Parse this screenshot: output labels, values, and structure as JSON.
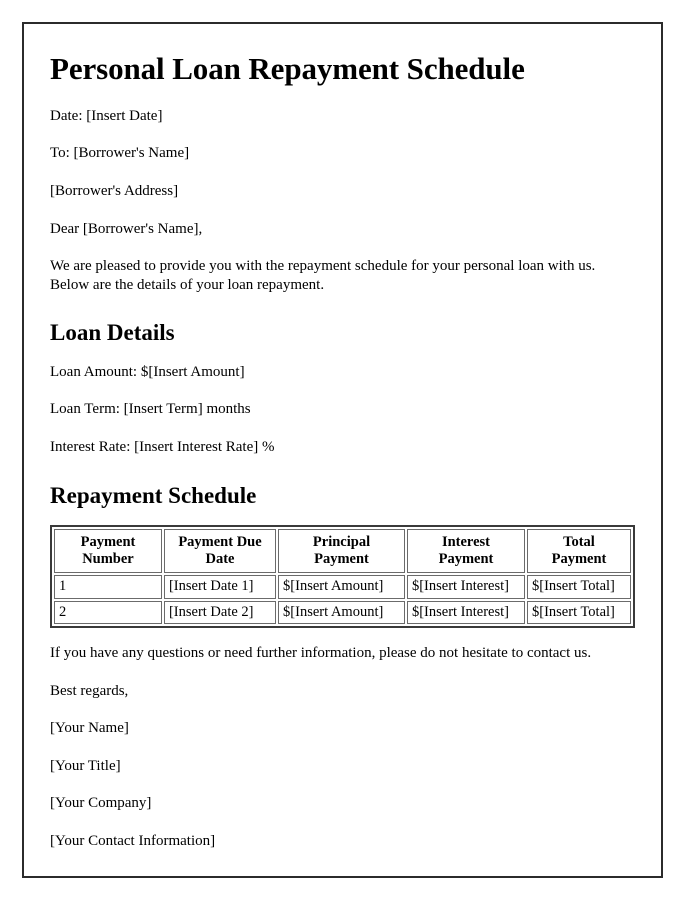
{
  "document": {
    "title": "Personal Loan Repayment Schedule",
    "header_lines": [
      "Date: [Insert Date]",
      "To: [Borrower's Name]",
      "[Borrower's Address]",
      "Dear [Borrower's Name],"
    ],
    "intro_paragraph": "We are pleased to provide you with the repayment schedule for your personal loan with us. Below are the details of your loan repayment.",
    "loan_details": {
      "heading": "Loan Details",
      "lines": [
        "Loan Amount: $[Insert Amount]",
        "Loan Term: [Insert Term] months",
        "Interest Rate: [Insert Interest Rate] %"
      ]
    },
    "repayment_schedule": {
      "heading": "Repayment Schedule",
      "columns": [
        "Payment\nNumber",
        "Payment Due\nDate",
        "Principal\nPayment",
        "Interest\nPayment",
        "Total\nPayment"
      ],
      "rows": [
        [
          "1",
          "[Insert Date 1]",
          "$[Insert Amount]",
          "$[Insert Interest]",
          "$[Insert Total]"
        ],
        [
          "2",
          "[Insert Date 2]",
          "$[Insert Amount]",
          "$[Insert Interest]",
          "$[Insert Total]"
        ]
      ]
    },
    "closing_paragraph": "If you have any questions or need further information, please do not hesitate to contact us.",
    "signature_lines": [
      "Best regards,",
      "[Your Name]",
      "[Your Title]",
      "[Your Company]",
      "[Your Contact Information]"
    ]
  },
  "colors": {
    "page_border": "#2b2b2b",
    "table_border": "#3a3a3a",
    "cell_border": "#6b6b6b",
    "text": "#000000"
  }
}
